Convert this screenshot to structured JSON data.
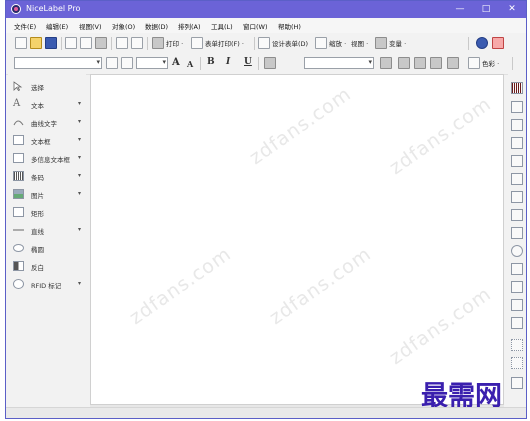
{
  "window": {
    "title": "NiceLabel Pro",
    "controls": [
      "—",
      "□",
      "✕"
    ]
  },
  "menu": [
    "文件(E)",
    "编辑(E)",
    "视图(V)",
    "对象(O)",
    "数据(D)",
    "排列(A)",
    "工具(L)",
    "窗口(W)",
    "帮助(H)"
  ],
  "toolbar1": {
    "print_label": "打印 ·",
    "form_print_label": "表单打印(F) ·",
    "design_form_label": "设计表单(D)",
    "zoom_label": "缩放 ·",
    "view_label": "视图 ·",
    "variable_label": "变量 ·"
  },
  "toolbar2": {
    "bold": "B",
    "italic": "I",
    "underline": "U",
    "grow_font": "A",
    "shrink_font": "A",
    "color_label": "色彩 ·"
  },
  "tools": [
    {
      "label": "选择",
      "arrow": ""
    },
    {
      "label": "文本",
      "arrow": "▾"
    },
    {
      "label": "曲线文字",
      "arrow": "▾"
    },
    {
      "label": "文本框",
      "arrow": "▾"
    },
    {
      "label": "多信息文本框",
      "arrow": "▾"
    },
    {
      "label": "条码",
      "arrow": "▾"
    },
    {
      "label": "图片",
      "arrow": "▾"
    },
    {
      "label": "矩形",
      "arrow": ""
    },
    {
      "label": "直线",
      "arrow": "▾"
    },
    {
      "label": "椭圆",
      "arrow": ""
    },
    {
      "label": "反白",
      "arrow": ""
    },
    {
      "label": "RFID 标记",
      "arrow": "▾"
    }
  ],
  "watermark": "zdfans.com",
  "brand_text": "最需网",
  "colors": {
    "titlebar": "#6b63d7",
    "brand": "#3a1fae"
  }
}
